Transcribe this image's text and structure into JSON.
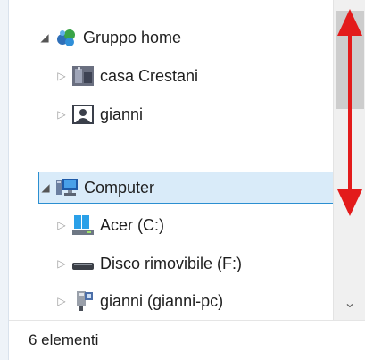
{
  "tree": {
    "items": [
      {
        "label": "Gruppo home",
        "icon": "homegroup-icon",
        "state": "expanded"
      },
      {
        "label": "casa Crestani",
        "icon": "computer-user-icon",
        "state": "collapsed"
      },
      {
        "label": "gianni",
        "icon": "user-icon",
        "state": "collapsed"
      },
      {
        "label": "Computer",
        "icon": "computer-icon",
        "state": "expanded",
        "selected": true
      },
      {
        "label": "Acer (C:)",
        "icon": "drive-windows-icon",
        "state": "collapsed"
      },
      {
        "label": "Disco rimovibile (F:)",
        "icon": "removable-drive-icon",
        "state": "collapsed"
      },
      {
        "label": "gianni (gianni-pc)",
        "icon": "network-drive-icon",
        "state": "collapsed"
      }
    ]
  },
  "status_bar": {
    "count_text": "6 elementi"
  },
  "colors": {
    "selection_bg": "#d9ebf9",
    "selection_border": "#2b8fd1",
    "annotation_arrow": "#e31b1b"
  },
  "annotations": [
    "up-arrow",
    "down-arrow"
  ]
}
